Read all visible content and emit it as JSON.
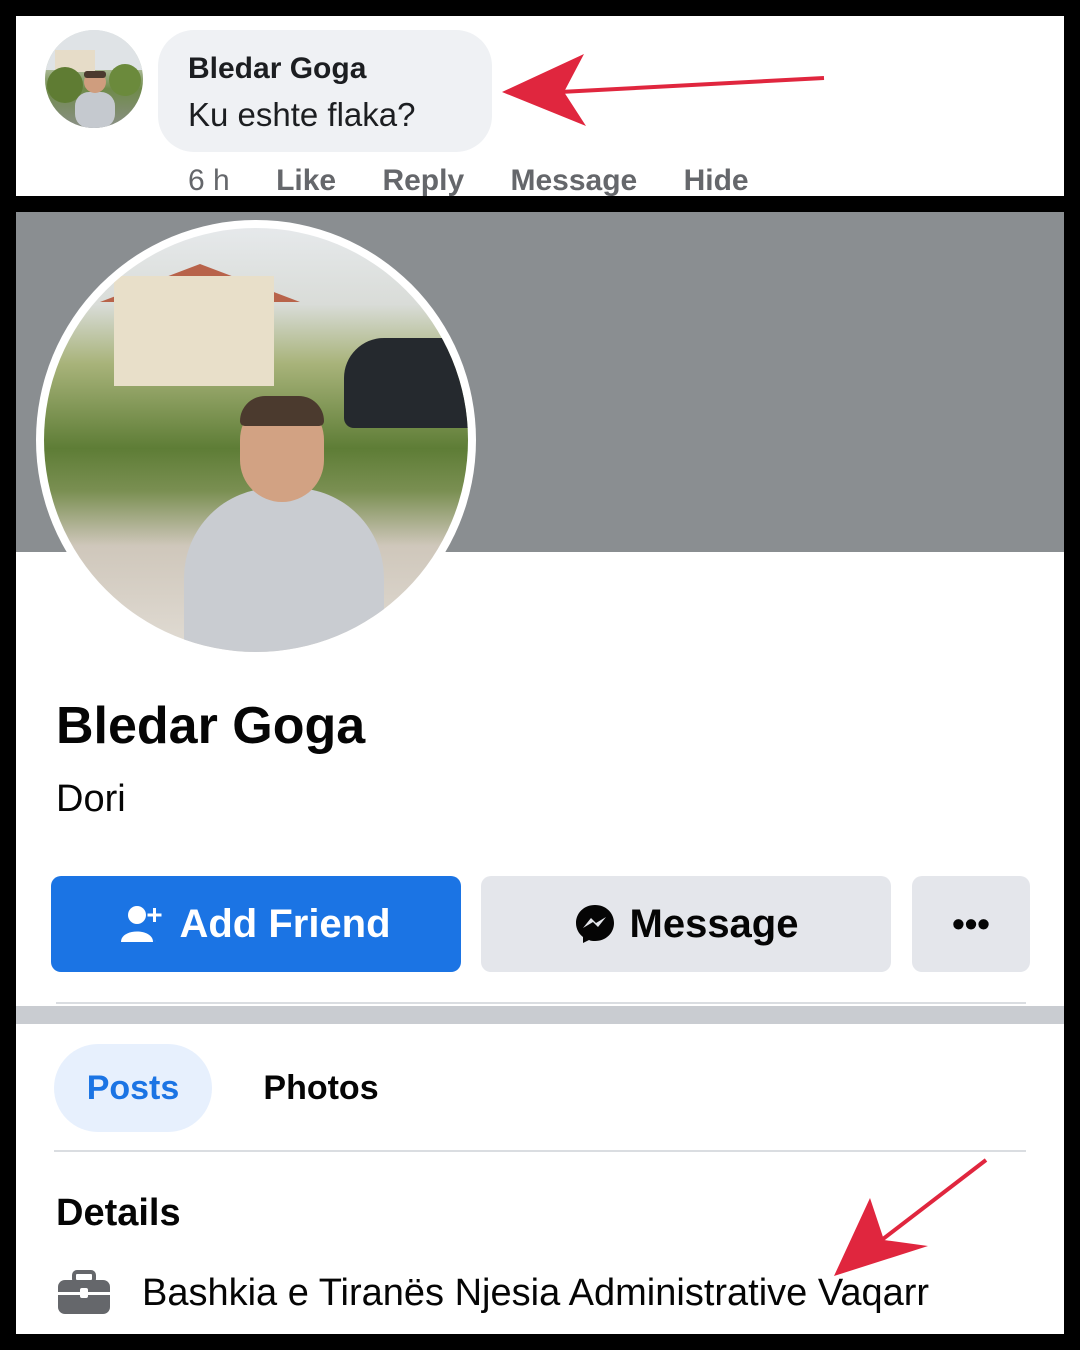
{
  "comment": {
    "author": "Bledar Goga",
    "text": "Ku eshte flaka?",
    "time": "6 h",
    "actions": [
      "Like",
      "Reply",
      "Message",
      "Hide"
    ]
  },
  "profile": {
    "name": "Bledar Goga",
    "subtitle": "Dori",
    "buttons": {
      "add_friend": "Add Friend",
      "message": "Message",
      "more": "•••"
    },
    "tabs": [
      "Posts",
      "Photos"
    ],
    "details_heading": "Details",
    "work": "Bashkia e Tiranës Njesia Administrative Vaqarr"
  },
  "colors": {
    "primary": "#1b74e4",
    "arrow": "#e0263e",
    "cover": "#8a8e91",
    "bubble": "#eff1f4"
  },
  "icons": [
    "add-friend-icon",
    "messenger-icon",
    "more-icon",
    "briefcase-icon",
    "arrow-annotation"
  ]
}
